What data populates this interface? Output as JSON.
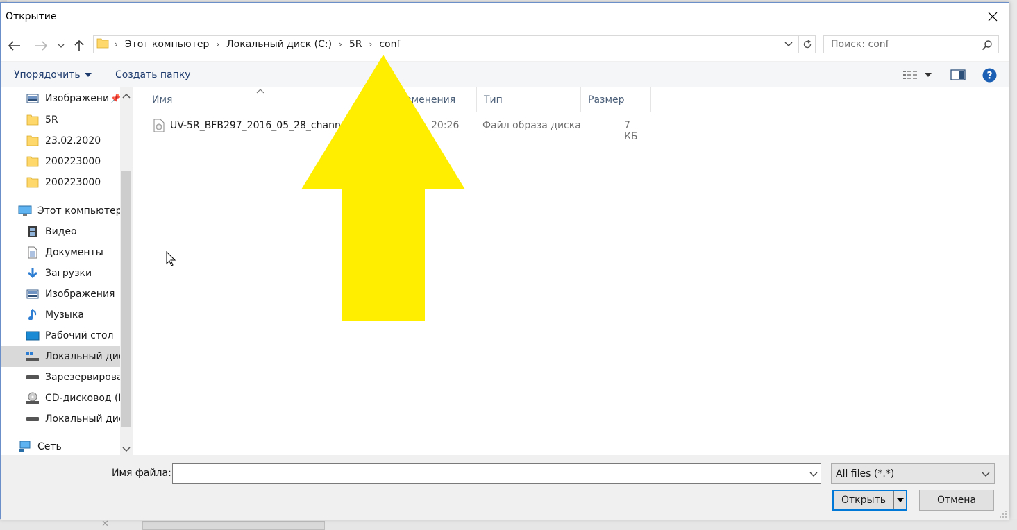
{
  "window": {
    "title": "Открытие"
  },
  "address_bar": {
    "crumbs": [
      "Этот компьютер",
      "Локальный диск (C:)",
      "5R",
      "conf"
    ]
  },
  "search": {
    "placeholder": "Поиск: conf"
  },
  "toolbar": {
    "organize_label": "Упорядочить",
    "new_folder_label": "Создать папку"
  },
  "sidebar": {
    "items": [
      {
        "label": "Изображени",
        "icon": "pictures-icon"
      },
      {
        "label": "5R",
        "icon": "folder-icon"
      },
      {
        "label": "23.02.2020",
        "icon": "folder-icon"
      },
      {
        "label": "200223000",
        "icon": "folder-icon"
      },
      {
        "label": "200223000",
        "icon": "folder-icon"
      },
      {
        "label": "Этот компьютер",
        "icon": "computer-icon"
      },
      {
        "label": "Видео",
        "icon": "video-icon"
      },
      {
        "label": "Документы",
        "icon": "documents-icon"
      },
      {
        "label": "Загрузки",
        "icon": "downloads-icon"
      },
      {
        "label": "Изображения",
        "icon": "pictures-icon"
      },
      {
        "label": "Музыка",
        "icon": "music-icon"
      },
      {
        "label": "Рабочий стол",
        "icon": "desktop-icon"
      },
      {
        "label": "Локальный дис",
        "icon": "drive-icon",
        "selected": true
      },
      {
        "label": "Зарезервирован",
        "icon": "drive-icon"
      },
      {
        "label": "CD-дисковод (E",
        "icon": "cd-drive-icon"
      },
      {
        "label": "Локальный дис",
        "icon": "drive-icon"
      },
      {
        "label": "Сеть",
        "icon": "network-icon"
      }
    ]
  },
  "columns": {
    "name": "Имя",
    "date": "изменения",
    "type": "Тип",
    "size": "Размер"
  },
  "files": [
    {
      "name": "UV-5R_BFB297_2016_05_28_channels.i",
      "date": "20:26",
      "type": "Файл образа диска",
      "size": "7 КБ"
    }
  ],
  "footer": {
    "filename_label": "Имя файла:",
    "filename_value": "",
    "filter_value": "All files (*.*)",
    "open_label": "Открыть",
    "cancel_label": "Отмена"
  },
  "colors": {
    "accent": "#0078d7",
    "arrow": "#ffee00",
    "selection": "#d9d9d9"
  }
}
